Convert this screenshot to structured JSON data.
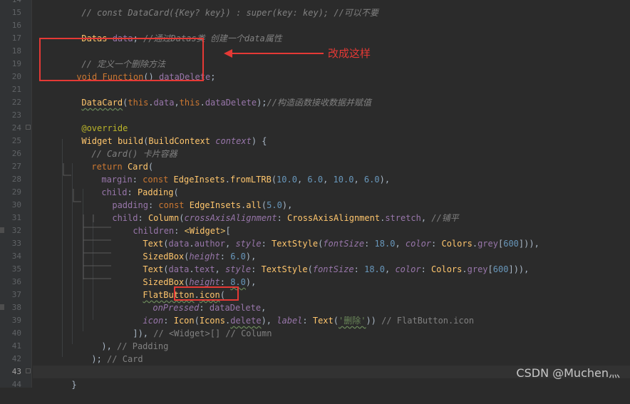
{
  "gutter": {
    "line_numbers": [
      "14",
      "15",
      "16",
      "17",
      "18",
      "19",
      "20",
      "21",
      "22",
      "23",
      "24",
      "25",
      "26",
      "27",
      "28",
      "29",
      "30",
      "31",
      "32",
      "33",
      "34",
      "35",
      "36",
      "37",
      "38",
      "39",
      "40",
      "41",
      "42",
      "43",
      "44"
    ],
    "current_line": "43"
  },
  "code": {
    "line14": "// const DataCard({Key? key}) : super(key: key); //可以不要",
    "line16": {
      "type": "Datas",
      "name": " data",
      "rest": ";",
      "comment": " //通过Datas类 创建一个data属性"
    },
    "line18": "// 定义一个删除方法",
    "line19": {
      "kw": "void",
      "type": " Function",
      "rest": "() ",
      "name": "dataDelete",
      "end": ";"
    },
    "line21": {
      "ctor": "DataCard",
      "open": "(",
      "this1": "this",
      "d1": ".",
      "f1": "data",
      "comma": ",",
      "this2": "this",
      "d2": ".",
      "f2": "dataDelete",
      "close": ");",
      "comment": "//构造函数接收数据并赋值"
    },
    "line23": "@override",
    "line24": {
      "type": "Widget",
      "fn": " build",
      "open": "(",
      "ptype": "BuildContext",
      "pname": " context",
      "close": ") {"
    },
    "line25": "// Card() 卡片容器",
    "line26": {
      "kw": "return",
      "cls": " Card",
      "open": "("
    },
    "line27": {
      "param": "margin",
      "colon": ": ",
      "kw": "const",
      "cls": " EdgeInsets",
      "dot": ".",
      "fn": "fromLTRB",
      "open": "(",
      "n1": "10.0",
      "n2": "6.0",
      "n3": "10.0",
      "n4": "6.0",
      "sep": ", ",
      "close": "),"
    },
    "line28": {
      "param": "child",
      "colon": ": ",
      "cls": "Padding",
      "open": "("
    },
    "line29": {
      "param": "padding",
      "colon": ": ",
      "kw": "const",
      "cls": " EdgeInsets",
      "dot": ".",
      "fn": "all",
      "open": "(",
      "n": "5.0",
      "close": "),"
    },
    "line30": {
      "param": "child",
      "colon": ": ",
      "cls": "Column",
      "open": "(",
      "p2": "crossAxisAlignment",
      "colon2": ": ",
      "cls2": "CrossAxisAlignment",
      "dot": ".",
      "f": "stretch",
      "close": ",",
      "comment": " //铺平"
    },
    "line31": {
      "param": "children",
      "colon": ": ",
      "lt": "<",
      "cls": "Widget",
      "gt": ">",
      "open": "["
    },
    "line32": {
      "cls": "Text",
      "open": "(",
      "obj": "data",
      "dot": ".",
      "f": "author",
      "comma": ", ",
      "p": "style",
      "colon": ": ",
      "cls2": "TextStyle",
      "open2": "(",
      "p2": "fontSize",
      "colon2": ": ",
      "n": "18.0",
      "comma2": ", ",
      "p3": "color",
      "colon3": ": ",
      "cls3": "Colors",
      "dot2": ".",
      "f2": "grey",
      "b1": "[",
      "n2": "600",
      "b2": "]",
      "close": ")),"
    },
    "line33": {
      "cls": "SizedBox",
      "open": "(",
      "p": "height",
      "colon": ": ",
      "n": "6.0",
      "close": "),"
    },
    "line34": {
      "cls": "Text",
      "open": "(",
      "obj": "data",
      "dot": ".",
      "f": "text",
      "comma": ", ",
      "p": "style",
      "colon": ": ",
      "cls2": "TextStyle",
      "open2": "(",
      "p2": "fontSize",
      "colon2": ": ",
      "n": "18.0",
      "comma2": ", ",
      "p3": "color",
      "colon3": ": ",
      "cls3": "Colors",
      "dot2": ".",
      "f2": "grey",
      "b1": "[",
      "n2": "600",
      "b2": "]",
      "close": ")),"
    },
    "line35": {
      "cls": "SizedBox",
      "open": "(",
      "p": "height",
      "colon": ": ",
      "n": "8.0",
      "close": "),"
    },
    "line36": {
      "cls": "FlatButton",
      "dot": ".",
      "fn": "icon",
      "open": "("
    },
    "line37": {
      "p": "onPressed",
      "colon": ": ",
      "v": "dataDelete",
      "comma": ","
    },
    "line38": {
      "p": "icon",
      "colon": ": ",
      "cls": "Icon",
      "open": "(",
      "cls2": "Icons",
      "dot": ".",
      "f": "delete",
      "close": "), ",
      "p2": "label",
      "colon2": ": ",
      "cls3": "Text",
      "open2": "(",
      "s": "'删除'",
      "close2": "))",
      "comment": " // FlatButton.icon"
    },
    "line39": {
      "code": "]), ",
      "comment": "// <Widget>[] // Column"
    },
    "line40": {
      "code": "), ",
      "comment": "// Padding"
    },
    "line41": {
      "code": "); ",
      "comment": "// Card"
    },
    "line42": "}",
    "line43": "}"
  },
  "annotations": {
    "note_text": "改成这样",
    "highlight_color": "#e53935"
  },
  "watermark": "CSDN @Muchen灬"
}
